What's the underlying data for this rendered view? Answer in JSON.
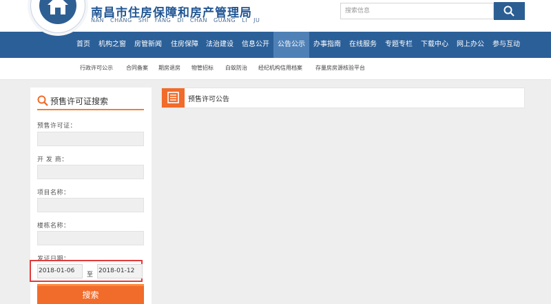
{
  "header": {
    "site_title": "南昌市住房保障和房产管理局",
    "site_subtitle": "NAN CHANG SHI FANG DI CHAN GUANG LI JU",
    "search_placeholder": "搜索信息"
  },
  "nav": {
    "items": [
      {
        "label": "首页"
      },
      {
        "label": "机构之窗"
      },
      {
        "label": "房管新闻"
      },
      {
        "label": "住房保障"
      },
      {
        "label": "法治建设"
      },
      {
        "label": "信息公开"
      },
      {
        "label": "公告公示",
        "active": true
      },
      {
        "label": "办事指南"
      },
      {
        "label": "在线服务"
      },
      {
        "label": "专题专栏"
      },
      {
        "label": "下载中心"
      },
      {
        "label": "网上办公"
      },
      {
        "label": "参与互动"
      }
    ]
  },
  "subnav": {
    "items": [
      {
        "label": "行政许可公示"
      },
      {
        "label": "合同备案"
      },
      {
        "label": "期房退房"
      },
      {
        "label": "物管招标"
      },
      {
        "label": "白蚁防治"
      },
      {
        "label": "经纪机构信用档案"
      },
      {
        "label": "存量房房源核验平台"
      }
    ]
  },
  "search_panel": {
    "title": "预售许可证搜索",
    "fields": [
      {
        "label": "预售许可证："
      },
      {
        "label": "开 发 商："
      },
      {
        "label": "项目名称："
      },
      {
        "label": "楼栋名称："
      }
    ],
    "date_label": "发证日期：",
    "date_from": "2018-01-06",
    "date_separator": "至",
    "date_to": "2018-01-12",
    "submit_label": "搜索"
  },
  "content": {
    "title": "预售许可公告"
  },
  "colors": {
    "brand_blue": "#2b5f98",
    "active_tab": "#4f81b7",
    "accent_orange": "#f16b2a",
    "highlight_red": "#e23a3a"
  }
}
